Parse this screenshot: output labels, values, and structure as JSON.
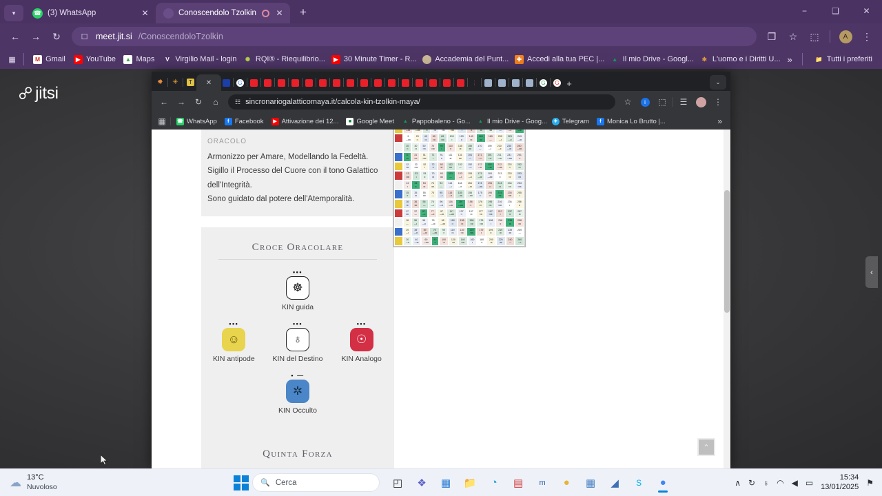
{
  "outer_browser": {
    "window_controls": {
      "minimize": "−",
      "maximize": "❑",
      "close": "✕"
    },
    "tabs": [
      {
        "title": "(3) WhatsApp",
        "favicon": "whatsapp-icon",
        "color": "#25D366",
        "glyph": "✆",
        "active": false,
        "recording": false
      },
      {
        "title": "Conoscendolo Tzolkin | Jitsi",
        "favicon": "jitsi-icon",
        "color": "#6a4e88",
        "glyph": "",
        "active": true,
        "recording": true
      }
    ],
    "new_tab_label": "+",
    "nav": {
      "back": "←",
      "forward": "→",
      "reload": "↻"
    },
    "omnibox": {
      "icon": "page-icon",
      "host": "meet.jit.si",
      "path": "/ConoscendoloTzolkin"
    },
    "toolbar_right": {
      "cast": "❐",
      "bookmark_star": "☆",
      "extensions": "⬚",
      "profile_initial": "A",
      "menu": "⋮"
    },
    "bookmarks": [
      {
        "label": "Gmail",
        "color": "#ffffff",
        "glyph": "M",
        "fg": "#d93025"
      },
      {
        "label": "YouTube",
        "color": "#ff0000",
        "glyph": "▶"
      },
      {
        "label": "Maps",
        "color": "#ffffff",
        "glyph": "🗺",
        "fg": "#34a853"
      },
      {
        "label": "Virgilio Mail - login",
        "color": "#ffffff",
        "glyph": "V",
        "fg": "#ffffff"
      },
      {
        "label": "RQI® - Riequilibrio...",
        "color": "#9bbf3f",
        "glyph": "✺"
      },
      {
        "label": "30 Minute Timer - R...",
        "color": "#ff0000",
        "glyph": "▶"
      },
      {
        "label": "Accademia del Punt...",
        "color": "#c9b896",
        "glyph": "●"
      },
      {
        "label": "Accedi alla tua PEC |...",
        "color": "#f5821f",
        "glyph": "✚"
      },
      {
        "label": "Il mio Drive - Googl...",
        "color": "#ffffff",
        "glyph": "▲",
        "fg": "#0f9d58"
      },
      {
        "label": "L'uomo e i Diritti U...",
        "color": "#ffffff",
        "glyph": "✻",
        "fg": "#e8a33d"
      }
    ],
    "bookmarks_overflow": "»",
    "bookmarks_all": {
      "label": "Tutti i preferiti",
      "icon": "folder-icon"
    },
    "apps_icon": "apps-grid-icon"
  },
  "jitsi": {
    "logo_text": "jitsi",
    "logo_mark": "☍",
    "sidebar_toggle": "‹"
  },
  "shared_screen": {
    "tabstrip": {
      "pinned": [
        {
          "name": "rqi-icon",
          "color": "#2a1a14",
          "glyph": "✸",
          "fg": "#e88b3a"
        },
        {
          "name": "star-icon",
          "color": "#2a1a14",
          "glyph": "✳",
          "fg": "#e8a33d"
        },
        {
          "name": "t-icon",
          "color": "#e0c243",
          "glyph": "T",
          "fg": "#1a1a1a"
        }
      ],
      "active_tab_close": "✕",
      "other_tabs": [
        {
          "name": "facebook-fav",
          "color": "#1b3ea8",
          "glyph": ""
        },
        {
          "name": "google-fav",
          "color": "#ffffff",
          "glyph": "G",
          "fg": "#4285f4"
        },
        {
          "name": "youtube-fav",
          "color": "#ff0000",
          "glyph": "▶"
        },
        {
          "name": "youtube-fav",
          "color": "#ff0000",
          "glyph": "▶"
        },
        {
          "name": "youtube-fav",
          "color": "#ff0000",
          "glyph": "▶"
        },
        {
          "name": "youtube-fav",
          "color": "#ff0000",
          "glyph": "▶"
        },
        {
          "name": "youtube-fav",
          "color": "#ff0000",
          "glyph": "▶"
        },
        {
          "name": "youtube-fav",
          "color": "#ff0000",
          "glyph": "▶"
        },
        {
          "name": "youtube-fav",
          "color": "#ff0000",
          "glyph": "▶"
        },
        {
          "name": "youtube-fav",
          "color": "#ff0000",
          "glyph": "▶"
        },
        {
          "name": "youtube-fav",
          "color": "#ff0000",
          "glyph": "▶"
        },
        {
          "name": "youtube-fav",
          "color": "#ff0000",
          "glyph": "▶"
        },
        {
          "name": "youtube-fav",
          "color": "#ff0000",
          "glyph": "▶"
        },
        {
          "name": "youtube-fav",
          "color": "#ff0000",
          "glyph": "▶"
        },
        {
          "name": "youtube-fav",
          "color": "#ff0000",
          "glyph": "▶"
        },
        {
          "name": "youtube-fav",
          "color": "#ff0000",
          "glyph": "▶"
        },
        {
          "name": "youtube-fav",
          "color": "#ff0000",
          "glyph": "▶"
        },
        {
          "name": "youtube-fav",
          "color": "#ff0000",
          "glyph": "▶"
        },
        {
          "name": "doc-fav",
          "color": "#8fa6c4",
          "glyph": "❖"
        },
        {
          "name": "doc-fav",
          "color": "#8fa6c4",
          "glyph": "❖"
        },
        {
          "name": "doc-fav",
          "color": "#8fa6c4",
          "glyph": "❖"
        },
        {
          "name": "doc-fav",
          "color": "#8fa6c4",
          "glyph": "❖"
        },
        {
          "name": "google-fav",
          "color": "#ffffff",
          "glyph": "G",
          "fg": "#34a853"
        },
        {
          "name": "google-fav",
          "color": "#ffffff",
          "glyph": "G",
          "fg": "#ea4335"
        }
      ],
      "new_tab": "+",
      "tab_search": "⌄"
    },
    "nav": {
      "back": "←",
      "forward": "→",
      "reload": "↻",
      "home": "⌂"
    },
    "omnibox": {
      "icon": "site-settings-icon",
      "url": "sincronariogalatticomaya.it/calcola-kin-tzolkin-maya/"
    },
    "toolbar_right": {
      "bookmark_star": "☆",
      "sync_badge": "i",
      "extensions": "⬚",
      "reading_list": "☰",
      "profile": "avatar-icon",
      "menu": "⋮"
    },
    "bookmarks": [
      {
        "label": "WhatsApp",
        "color": "#ffffff",
        "glyph": "✆",
        "fg": "#25D366"
      },
      {
        "label": "Facebook",
        "color": "#1877f2",
        "glyph": "f"
      },
      {
        "label": "Attivazione dei 12...",
        "color": "#ff0000",
        "glyph": "▶"
      },
      {
        "label": "Google Meet",
        "color": "#ffffff",
        "glyph": "■",
        "fg": "#00832d"
      },
      {
        "label": "Pappobaleno - Go...",
        "color": "#ffffff",
        "glyph": "▲",
        "fg": "#0f9d58"
      },
      {
        "label": "Il mio Drive - Goog...",
        "color": "#ffffff",
        "glyph": "▲",
        "fg": "#0f9d58"
      },
      {
        "label": "Telegram",
        "color": "#2aabee",
        "glyph": "✈"
      },
      {
        "label": "Monica Lo Brutto |...",
        "color": "#1877f2",
        "glyph": "f"
      }
    ],
    "bookmarks_overflow": "»",
    "apps_icon": "apps-grid-icon",
    "page": {
      "oracolo": {
        "kicker": "Oracolo",
        "lines": [
          "Armonizzo per Amare, Modellando la Fedeltà.",
          "Sigillo il Processo del Cuore con il tono Galattico",
          "dell'Integrità.",
          "Sono guidato dal potere dell'Atemporalità."
        ]
      },
      "croce_oracolare": {
        "title": "Croce Oracolare",
        "guida": {
          "label": "KIN guida",
          "dots": "•••",
          "bg": "#ffffff",
          "fg": "#1b1b1b",
          "glyph": "☸"
        },
        "antipode": {
          "label": "KIN antipode",
          "dots": "•••",
          "bg": "#e8d44d",
          "fg": "#6b5c10",
          "glyph": "☺"
        },
        "destino": {
          "label": "KIN del Destino",
          "dots": "•••",
          "bg": "#ffffff",
          "fg": "#1b1b1b",
          "glyph": "♁"
        },
        "analogo": {
          "label": "KIN Analogo",
          "dots": "•••",
          "bg": "#d32f45",
          "fg": "#ffffff",
          "glyph": "☍"
        },
        "occulto": {
          "label": "KIN Occulto",
          "dots": "• —",
          "bg": "#4a86c8",
          "fg": "#17334f",
          "glyph": "✲"
        }
      },
      "quinta_forza": {
        "title": "Quinta Forza"
      },
      "scroll_top_button": "⌃"
    },
    "tzolkin": {
      "caption": "Tzolkin 260-kin matrix",
      "rows": 20,
      "cols": 13,
      "seal_colors": [
        "#cc3b3b",
        "#f0f0f0",
        "#3b6fcc",
        "#e8c93b",
        "#cc3b3b",
        "#f0f0f0",
        "#3b6fcc",
        "#e8c93b",
        "#cc3b3b",
        "#f0f0f0",
        "#3b6fcc",
        "#e8c93b",
        "#cc3b3b",
        "#f0f0f0",
        "#3b6fcc",
        "#e8c93b",
        "#cc3b3b",
        "#f0f0f0",
        "#3b6fcc",
        "#e8c93b"
      ],
      "cell_palette": [
        "#f4e9e6",
        "#dfe7f2",
        "#f7f4e2",
        "#e7f3ea",
        "#ffffff",
        "#3fb07a",
        "#f0dcd6",
        "#dbeadf",
        "#e9eef7",
        "#fbf7e4",
        "#f6e3dd",
        "#cfe6d8",
        "#eef1f8"
      ]
    }
  },
  "taskbar": {
    "weather": {
      "temp": "13°C",
      "condition": "Nuvoloso",
      "icon": "cloud-icon"
    },
    "start": "windows-start-icon",
    "search": {
      "placeholder": "Cerca",
      "icon": "search-icon"
    },
    "apps": [
      {
        "name": "task-view",
        "glyph": "◰",
        "color": "#2b2b2b"
      },
      {
        "name": "teams",
        "glyph": "❖",
        "color": "#5b5fc7"
      },
      {
        "name": "outlook-calendar",
        "glyph": "▦",
        "color": "#2b7cd3"
      },
      {
        "name": "file-explorer",
        "glyph": "🗀",
        "color": "#f0b429"
      },
      {
        "name": "edge",
        "glyph": "◔",
        "color": "#1a9cd8"
      },
      {
        "name": "microsoft-store",
        "glyph": "▤",
        "color": "#d23c3c"
      },
      {
        "name": "mydp-app",
        "glyph": "m",
        "color": "#2a5ca8"
      },
      {
        "name": "whatsapp-ball",
        "glyph": "●",
        "color": "#e8b33a"
      },
      {
        "name": "calculator",
        "glyph": "▦",
        "color": "#4a7fc1"
      },
      {
        "name": "snipping-tool",
        "glyph": "◢",
        "color": "#3f6fb5"
      },
      {
        "name": "skype",
        "glyph": "S",
        "color": "#00aff0"
      },
      {
        "name": "chrome",
        "glyph": "●",
        "color": "#4285f4",
        "active": true
      }
    ],
    "tray": {
      "chevron": "∧",
      "network_share": "↻",
      "mic": "♁",
      "wifi": "◠",
      "volume": "◀",
      "battery": "▭",
      "notification": "⚑"
    },
    "clock": {
      "time": "15:34",
      "date": "13/01/2025"
    }
  }
}
